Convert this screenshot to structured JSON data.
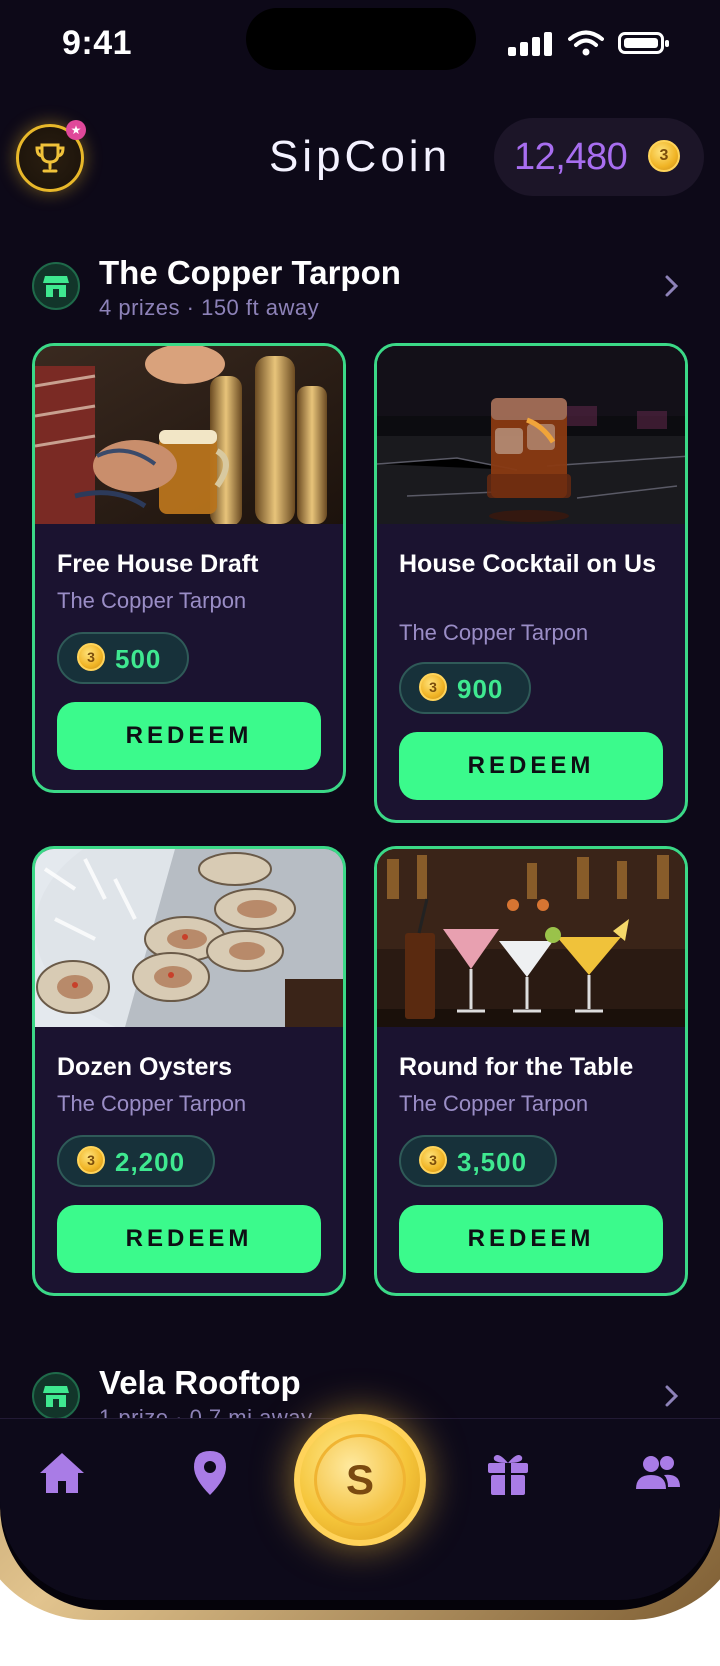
{
  "status_bar": {
    "time": "9:41"
  },
  "header": {
    "app_title": "SipCoin",
    "balance": "12,480",
    "coin_glyph": "3"
  },
  "venues": [
    {
      "name": "The Copper Tarpon",
      "subtitle": "4 prizes · 150 ft away",
      "prizes": [
        {
          "title": "Free House Draft",
          "venue": "The Copper Tarpon",
          "price": "500",
          "action": "REDEEM"
        },
        {
          "title": "House Cocktail on Us",
          "venue": "The Copper Tarpon",
          "price": "900",
          "action": "REDEEM"
        },
        {
          "title": "Dozen Oysters",
          "venue": "The Copper Tarpon",
          "price": "2,200",
          "action": "REDEEM"
        },
        {
          "title": "Round for the Table",
          "venue": "The Copper Tarpon",
          "price": "3,500",
          "action": "REDEEM"
        }
      ]
    },
    {
      "name": "Vela Rooftop",
      "subtitle": "1 prize · 0.7 mi away"
    }
  ],
  "nav": {
    "items": [
      "home-icon",
      "map-pin-icon",
      "mint-coin",
      "gift-icon",
      "friends-icon"
    ],
    "center_label": "S"
  },
  "colors": {
    "background": "#0d0918",
    "accent_green": "#3bfa8c",
    "accent_purple": "#a86ef0",
    "coin_gold": "#f0b425"
  }
}
